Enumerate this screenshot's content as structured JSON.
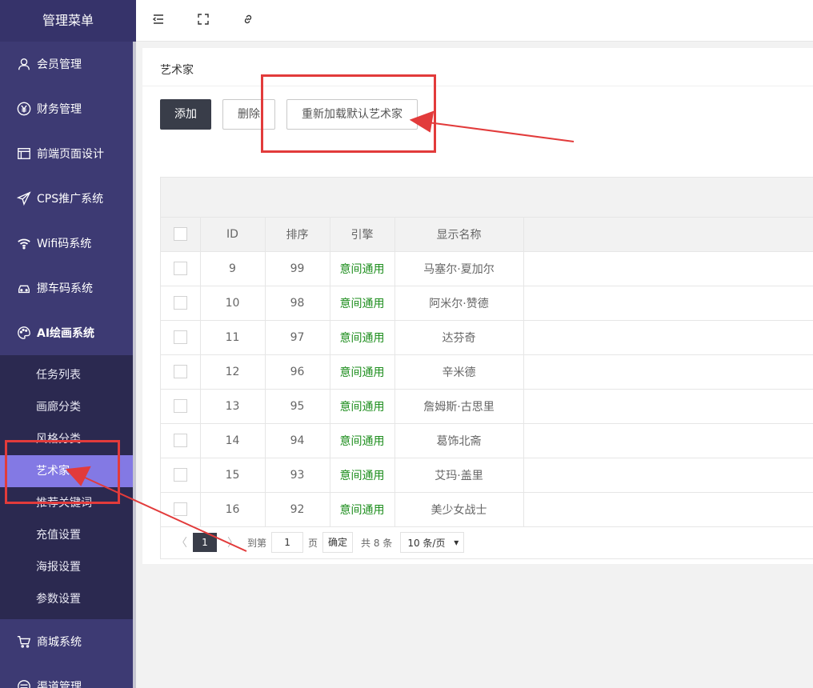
{
  "sidebar": {
    "title": "管理菜单",
    "items": [
      {
        "label": "会员管理",
        "icon": "user-icon"
      },
      {
        "label": "财务管理",
        "icon": "yen-icon"
      },
      {
        "label": "前端页面设计",
        "icon": "layout-icon"
      },
      {
        "label": "CPS推广系统",
        "icon": "paper-plane-icon"
      },
      {
        "label": "Wifi码系统",
        "icon": "wifi-icon"
      },
      {
        "label": "挪车码系统",
        "icon": "car-icon"
      },
      {
        "label": "AI绘画系统",
        "icon": "palette-icon"
      }
    ],
    "submenu": [
      {
        "label": "任务列表"
      },
      {
        "label": "画廊分类"
      },
      {
        "label": "风格分类"
      },
      {
        "label": "艺术家",
        "active": true
      },
      {
        "label": "推荐关键词"
      },
      {
        "label": "充值设置"
      },
      {
        "label": "海报设置"
      },
      {
        "label": "参数设置"
      }
    ],
    "bottom_items": [
      {
        "label": "商城系统",
        "icon": "cart-icon"
      },
      {
        "label": "渠道管理",
        "icon": "channel-icon"
      }
    ]
  },
  "topbar": {
    "icons": [
      "menu-fold-icon",
      "fullscreen-icon",
      "link-icon"
    ]
  },
  "page": {
    "title": "艺术家",
    "buttons": {
      "add": "添加",
      "delete": "删除",
      "reload": "重新加载默认艺术家"
    }
  },
  "table": {
    "headers": [
      "ID",
      "排序",
      "引擎",
      "显示名称"
    ],
    "rows": [
      {
        "id": "9",
        "sort": "99",
        "engine": "意间通用",
        "name": "马塞尔·夏加尔"
      },
      {
        "id": "10",
        "sort": "98",
        "engine": "意间通用",
        "name": "阿米尔·赞德"
      },
      {
        "id": "11",
        "sort": "97",
        "engine": "意间通用",
        "name": "达芬奇"
      },
      {
        "id": "12",
        "sort": "96",
        "engine": "意间通用",
        "name": "辛米德"
      },
      {
        "id": "13",
        "sort": "95",
        "engine": "意间通用",
        "name": "詹姆斯·古思里"
      },
      {
        "id": "14",
        "sort": "94",
        "engine": "意间通用",
        "name": "葛饰北斋"
      },
      {
        "id": "15",
        "sort": "93",
        "engine": "意间通用",
        "name": "艾玛·盖里"
      },
      {
        "id": "16",
        "sort": "92",
        "engine": "意间通用",
        "name": "美少女战士"
      }
    ]
  },
  "pager": {
    "prev": "〈",
    "next": "〉",
    "current": "1",
    "goto_label": "到第",
    "goto_value": "1",
    "page_unit": "页",
    "confirm": "确定",
    "total": "共 8 条",
    "per_page": "10 条/页"
  },
  "colors": {
    "sidebar_bg": "#3d3a73",
    "submenu_bg": "#2b2950",
    "active_item": "#8379e4",
    "dark_button": "#393d49",
    "engine_text": "#1e8e1e",
    "annotation": "#e23b3b"
  }
}
